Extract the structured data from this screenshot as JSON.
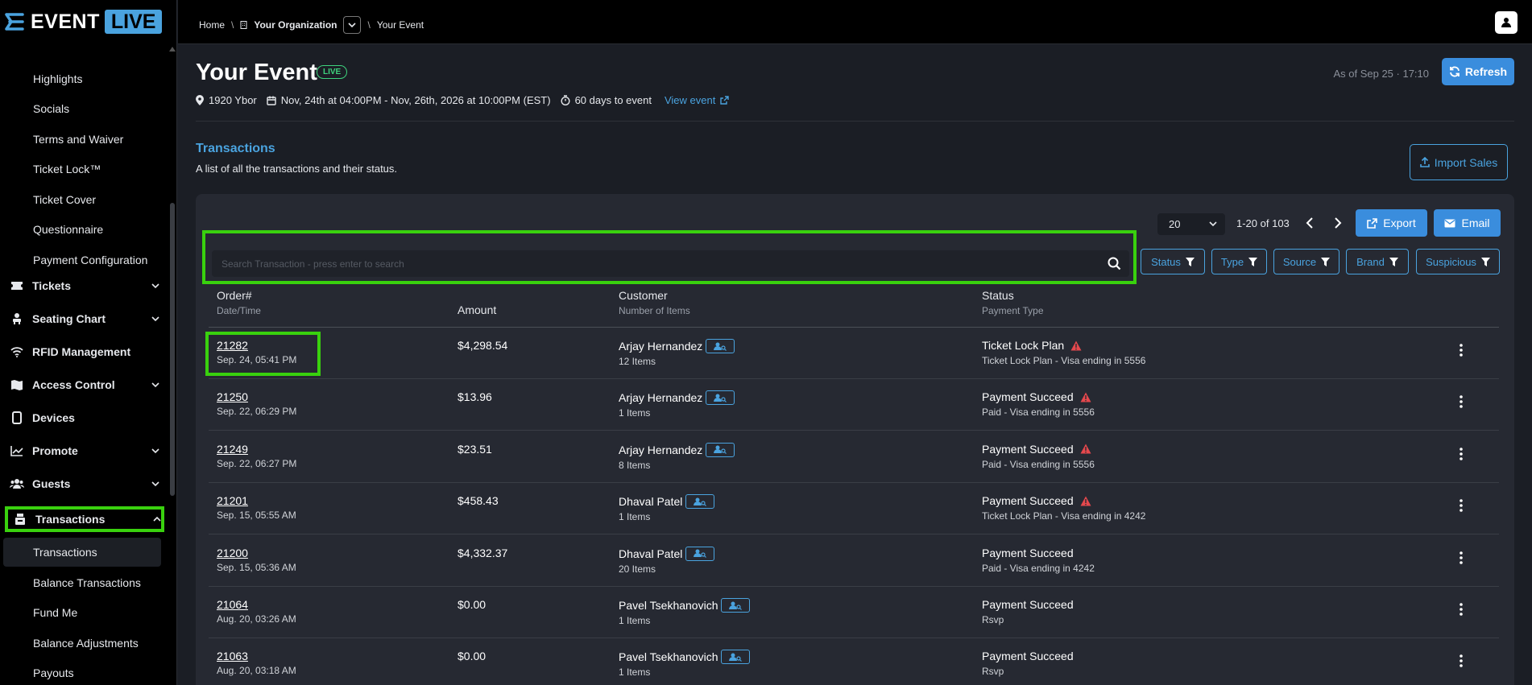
{
  "brand": {
    "word": "EVENT",
    "live": "LIVE",
    "accent": "#4aa3df"
  },
  "sidebar": {
    "top_items": [
      "Highlights",
      "Socials",
      "Terms and Waiver",
      "Ticket Lock™",
      "Ticket Cover",
      "Questionnaire",
      "Payment Configuration"
    ],
    "sections": [
      {
        "label": "Tickets",
        "icon": "ticket-icon"
      },
      {
        "label": "Seating Chart",
        "icon": "seat-icon"
      },
      {
        "label": "RFID Management",
        "icon": "wifi-icon"
      },
      {
        "label": "Access Control",
        "icon": "map-icon"
      },
      {
        "label": "Devices",
        "icon": "tablet-icon"
      },
      {
        "label": "Promote",
        "icon": "chart-icon"
      },
      {
        "label": "Guests",
        "icon": "users-icon"
      },
      {
        "label": "Transactions",
        "icon": "register-icon"
      }
    ],
    "sub_items": [
      "Transactions",
      "Balance Transactions",
      "Fund Me",
      "Balance Adjustments",
      "Payouts"
    ]
  },
  "breadcrumb": {
    "home": "Home",
    "org": "Your Organization",
    "event": "Your Event"
  },
  "event": {
    "title": "Your Event",
    "live_badge": "LIVE",
    "as_of": "As of Sep 25 · 17:10",
    "refresh": "Refresh",
    "venue": "1920 Ybor",
    "dates": "Nov, 24th at 04:00PM - Nov, 26th, 2026 at 10:00PM (EST)",
    "countdown": "60 days to event",
    "view_event": "View event"
  },
  "section": {
    "title": "Transactions",
    "subtitle": "A list of all the transactions and their status.",
    "import": "Import Sales"
  },
  "toolbar": {
    "per_page": "20",
    "range": "1-20 of 103",
    "export": "Export",
    "email": "Email",
    "search_placeholder": "Search Transaction - press enter to search",
    "filters": [
      "Status",
      "Type",
      "Source",
      "Brand",
      "Suspicious"
    ]
  },
  "table": {
    "headers": {
      "order": "Order#",
      "datetime": "Date/Time",
      "amount": "Amount",
      "customer": "Customer",
      "num_items": "Number of Items",
      "status": "Status",
      "payment_type": "Payment Type"
    },
    "rows": [
      {
        "order": "21282",
        "date": "Sep. 24, 05:41 PM",
        "amount": "$4,298.54",
        "customer": "Arjay Hernandez",
        "items": "12 Items",
        "status": "Ticket Lock Plan",
        "warn": true,
        "ptype": "Ticket Lock Plan - Visa ending in 5556"
      },
      {
        "order": "21250",
        "date": "Sep. 22, 06:29 PM",
        "amount": "$13.96",
        "customer": "Arjay Hernandez",
        "items": "1 Items",
        "status": "Payment Succeed",
        "warn": true,
        "ptype": "Paid - Visa ending in 5556"
      },
      {
        "order": "21249",
        "date": "Sep. 22, 06:27 PM",
        "amount": "$23.51",
        "customer": "Arjay Hernandez",
        "items": "8 Items",
        "status": "Payment Succeed",
        "warn": true,
        "ptype": "Paid - Visa ending in 5556"
      },
      {
        "order": "21201",
        "date": "Sep. 15, 05:55 AM",
        "amount": "$458.43",
        "customer": "Dhaval Patel",
        "items": "1 Items",
        "status": "Payment Succeed",
        "warn": true,
        "ptype": "Ticket Lock Plan - Visa ending in 4242"
      },
      {
        "order": "21200",
        "date": "Sep. 15, 05:36 AM",
        "amount": "$4,332.37",
        "customer": "Dhaval Patel",
        "items": "20 Items",
        "status": "Payment Succeed",
        "warn": false,
        "ptype": "Paid - Visa ending in 4242"
      },
      {
        "order": "21064",
        "date": "Aug. 20, 03:26 AM",
        "amount": "$0.00",
        "customer": "Pavel Tsekhanovich",
        "items": "1 Items",
        "status": "Payment Succeed",
        "warn": false,
        "ptype": "Rsvp"
      },
      {
        "order": "21063",
        "date": "Aug. 20, 03:18 AM",
        "amount": "$0.00",
        "customer": "Pavel Tsekhanovich",
        "items": "1 Items",
        "status": "Payment Succeed",
        "warn": false,
        "ptype": "Rsvp"
      }
    ]
  }
}
